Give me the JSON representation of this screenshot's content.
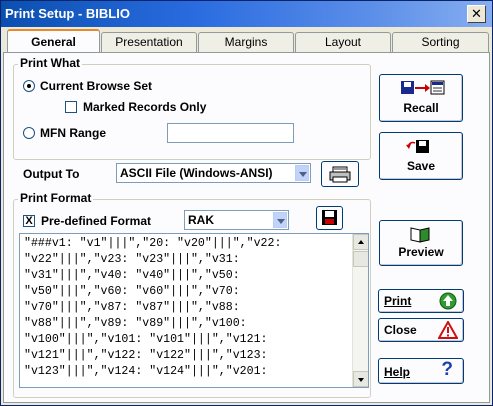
{
  "window": {
    "title": "Print Setup - BIBLIO",
    "close_label": "✕"
  },
  "tabs": [
    {
      "label": "General",
      "active": true
    },
    {
      "label": "Presentation",
      "active": false
    },
    {
      "label": "Margins",
      "active": false
    },
    {
      "label": "Layout",
      "active": false
    },
    {
      "label": "Sorting",
      "active": false
    }
  ],
  "print_what": {
    "title": "Print What",
    "current_browse_set": "Current Browse Set",
    "marked_records_only": "Marked Records Only",
    "mfn_range": "MFN Range",
    "mfn_range_value": "",
    "selected": "current_browse_set",
    "marked_checked": false
  },
  "output_to": {
    "label": "Output To",
    "value": "ASCII File (Windows-ANSI)"
  },
  "print_format": {
    "title": "Print Format",
    "predefined_label": "Pre-defined Format",
    "predefined_checked": true,
    "check_mark": "X",
    "format_value": "RAK",
    "lines": [
      "\"###v1: \"v1\"|||\",\"20: \"v20\"|||\",\"v22:",
      "\"v22\"|||\",\"v23: \"v23\"|||\",\"v31:",
      "\"v31\"|||\",\"v40: \"v40\"|||\",\"v50:",
      "\"v50\"|||\",\"v60: \"v60\"|||\",\"v70:",
      "\"v70\"|||\",\"v87: \"v87\"|||\",\"v88:",
      "\"v88\"|||\",\"v89: \"v89\"|||\",\"v100:",
      "\"v100\"|||\",\"v101: \"v101\"|||\",\"v121:",
      "\"v121\"|||\",\"v122: \"v122\"|||\",\"v123:",
      "\"v123\"|||\",\"v124: \"v124\"|||\",\"v201:"
    ]
  },
  "buttons": {
    "recall": "Recall",
    "save": "Save",
    "preview": "Preview",
    "print": "Print",
    "close": "Close",
    "help": "Help",
    "help_glyph": "?"
  },
  "icons": {
    "recall": "floppy-to-form-icon",
    "save": "arrow-to-floppy-icon",
    "preview": "open-book-icon",
    "printer": "printer-icon",
    "floppy": "floppy-disk-icon",
    "print": "green-up-arrow-icon",
    "close": "red-warning-triangle-icon",
    "help": "question-mark-icon"
  },
  "colors": {
    "title_bar": "#0a4fb0",
    "tab_active_accent": "#e68b2c",
    "button_border": "#003c74",
    "print_icon": "#2e9c2e",
    "close_icon": "#d01010",
    "help_icon": "#1d3fb0"
  }
}
